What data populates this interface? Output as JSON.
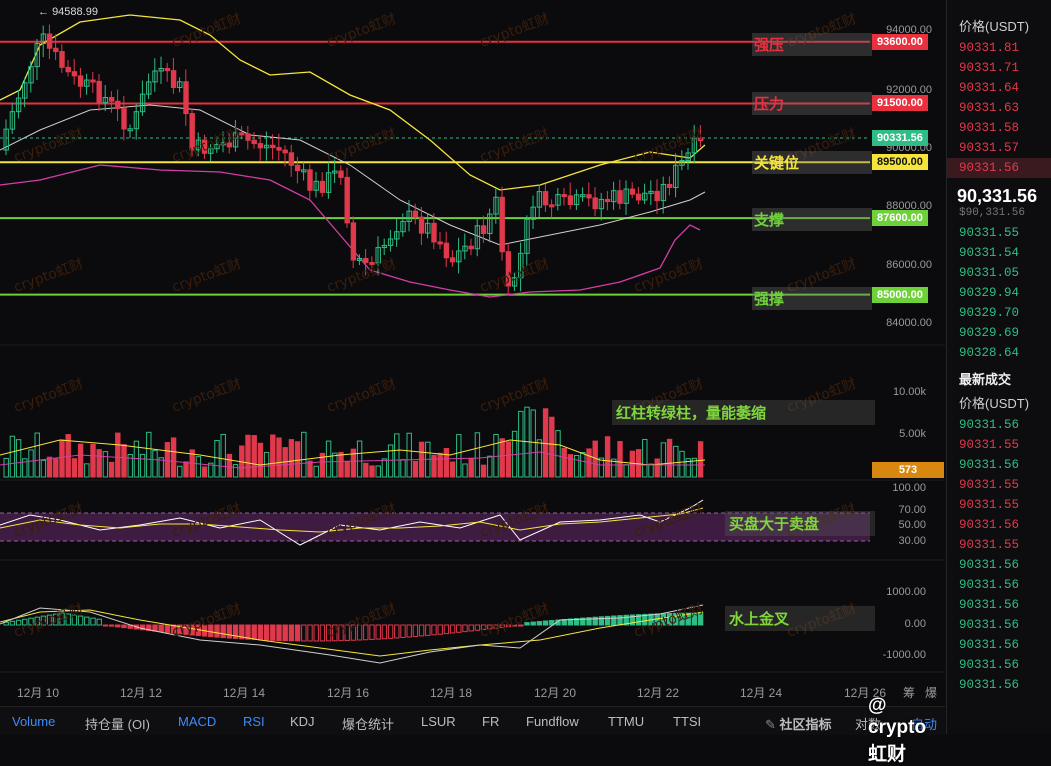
{
  "price_axis": {
    "ticks": [
      "94000.00",
      "92000.00",
      "90000.00",
      "88000.00",
      "86000.00",
      "84000.00"
    ],
    "high_marker": "94588.99"
  },
  "levels": [
    {
      "label": "强压",
      "tag": "93600.00",
      "color": "#e8303f",
      "label_color": "#e8303f"
    },
    {
      "label": "压力",
      "tag": "91500.00",
      "color": "#e8303f",
      "label_color": "#e8303f"
    },
    {
      "label": "关键位",
      "tag": "89500.00",
      "color": "#f5e53a",
      "label_color": "#f5e53a"
    },
    {
      "label": "支撑",
      "tag": "87600.00",
      "color": "#6ed13a",
      "label_color": "#6ed13a"
    },
    {
      "label": "强撑",
      "tag": "85000.00",
      "color": "#6ed13a",
      "label_color": "#6ed13a"
    }
  ],
  "current_price_tag": "90331.56",
  "volume": {
    "ticks": [
      "10.00k",
      "5.00k"
    ],
    "current_tag": "573",
    "note": "红柱转绿柱，量能萎缩"
  },
  "rsi": {
    "ticks": [
      "100.00",
      "70.00",
      "50.00",
      "30.00"
    ],
    "note": "买盘大于卖盘"
  },
  "macd": {
    "ticks": [
      "1000.00",
      "0.00",
      "-1000.00"
    ],
    "note": "水上金叉"
  },
  "dates": [
    "12月 10",
    "12月 12",
    "12月 14",
    "12月 16",
    "12月 18",
    "12月 20",
    "12月 22",
    "12月 24",
    "12月 26"
  ],
  "date_right_labels": [
    "筹",
    "爆"
  ],
  "watermark": "crypto虹财",
  "bottom_tabs": [
    "Volume",
    "持仓量 (OI)",
    "MACD",
    "RSI",
    "KDJ",
    "爆仓统计",
    "LSUR",
    "FR",
    "Fundflow",
    "TTMU",
    "TTSI"
  ],
  "community": {
    "label": "社区指标",
    "compare": "对数",
    "auto": "自动",
    "brand": "@ crypto虹财"
  },
  "right_panel": {
    "price_header": "价格(USDT)",
    "asks": [
      "90331.81",
      "90331.71",
      "90331.64",
      "90331.63",
      "90331.58",
      "90331.57",
      "90331.56"
    ],
    "last_price": "90,331.56",
    "mark_price": "$90,331.56",
    "bids": [
      "90331.55",
      "90331.54",
      "90331.05",
      "90329.94",
      "90329.70",
      "90329.69",
      "90328.64"
    ],
    "trades_header": "最新成交",
    "trades_price_header": "价格(USDT)",
    "trades": [
      {
        "p": "90331.56",
        "dir": "up"
      },
      {
        "p": "90331.55",
        "dir": "dn"
      },
      {
        "p": "90331.56",
        "dir": "up"
      },
      {
        "p": "90331.55",
        "dir": "dn"
      },
      {
        "p": "90331.55",
        "dir": "dn"
      },
      {
        "p": "90331.56",
        "dir": "dn"
      },
      {
        "p": "90331.55",
        "dir": "dn"
      },
      {
        "p": "90331.56",
        "dir": "up"
      },
      {
        "p": "90331.56",
        "dir": "up"
      },
      {
        "p": "90331.56",
        "dir": "up"
      },
      {
        "p": "90331.56",
        "dir": "up"
      },
      {
        "p": "90331.56",
        "dir": "up"
      },
      {
        "p": "90331.56",
        "dir": "up"
      },
      {
        "p": "90331.56",
        "dir": "up"
      }
    ]
  },
  "colors": {
    "up": "#2ebd85",
    "down": "#e0394b",
    "bg": "#0b0b0d",
    "accent": "#3d8bfd",
    "mid_band": "#f5e53a"
  }
}
